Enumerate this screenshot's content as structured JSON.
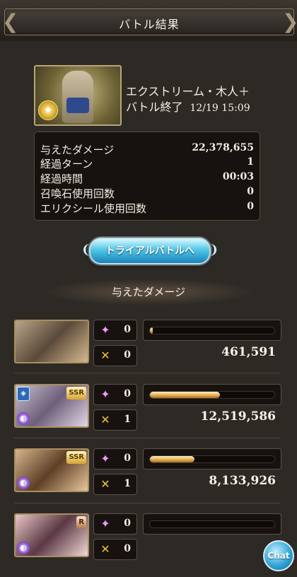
{
  "header": {
    "title": "バトル結果"
  },
  "quest": {
    "name": "エクストリーム・木人＋",
    "status": "バトル終了",
    "datetime": "12/19 15:09"
  },
  "stats": [
    {
      "label": "与えたダメージ",
      "value": "22,378,655"
    },
    {
      "label": "経過ターン",
      "value": "1"
    },
    {
      "label": "経過時間",
      "value": "00:03"
    },
    {
      "label": "召喚石使用回数",
      "value": "0"
    },
    {
      "label": "エリクシール使用回数",
      "value": "0"
    }
  ],
  "trial_button": {
    "label": "トライアルバトルへ"
  },
  "damage_section": {
    "title": "与えたダメージ"
  },
  "characters": [
    {
      "sparkle_count": "0",
      "cross_count": "0",
      "damage": "461,591",
      "damage_share": 0.02,
      "rarity": ""
    },
    {
      "sparkle_count": "0",
      "cross_count": "1",
      "damage": "12,519,586",
      "damage_share": 0.56,
      "rarity": "SSR"
    },
    {
      "sparkle_count": "0",
      "cross_count": "1",
      "damage": "8,133,926",
      "damage_share": 0.36,
      "rarity": "SSR"
    },
    {
      "sparkle_count": "0",
      "cross_count": "0",
      "damage": "",
      "damage_share": 0.0,
      "rarity": "R"
    }
  ],
  "chat_button": {
    "label": "Chat"
  },
  "colors": {
    "accent_blue": "#50c6e8",
    "bar_gold": "#e1a54a",
    "panel": "#17120f"
  }
}
